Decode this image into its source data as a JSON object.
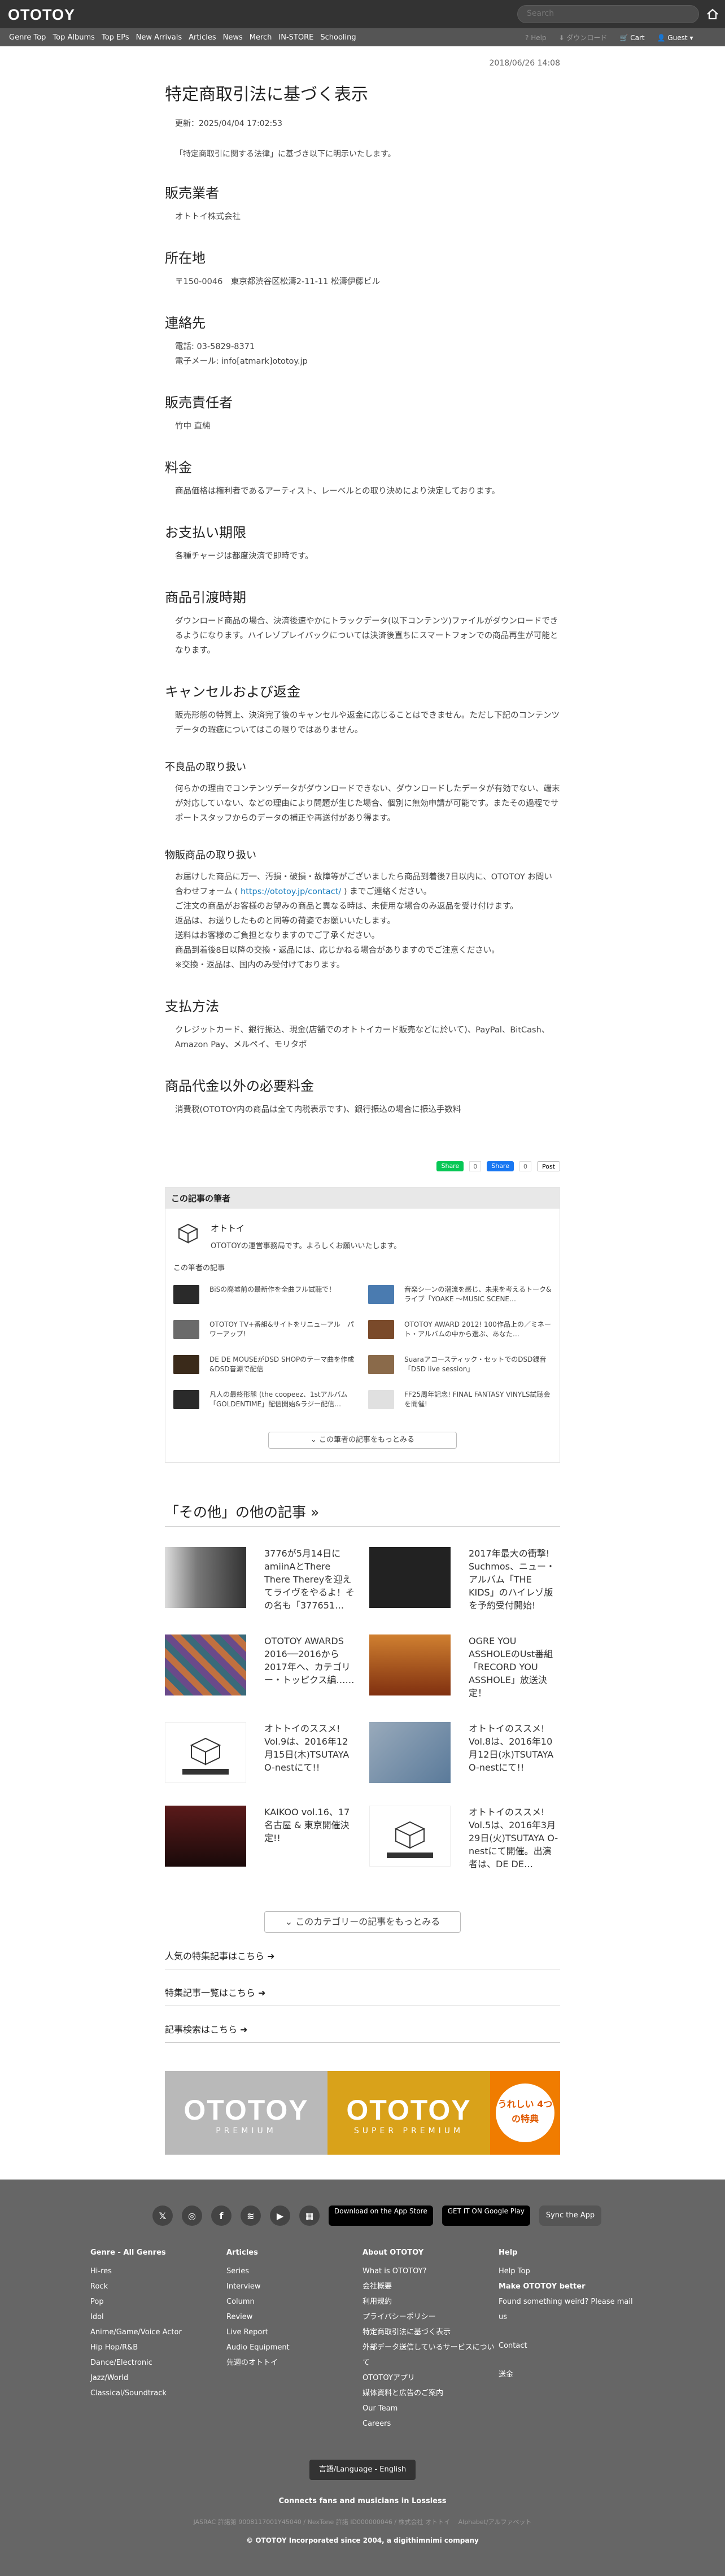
{
  "header": {
    "logo": "OTOTOY",
    "search_placeholder": "Search",
    "nav": [
      "Genre Top",
      "Top Albums",
      "Top EPs",
      "New Arrivals",
      "Articles",
      "News",
      "Merch",
      "IN-STORE",
      "Schooling"
    ],
    "help": "Help",
    "downloads": "ダウンロード",
    "cart": "Cart",
    "guest": "Guest"
  },
  "page": {
    "date": "2018/06/26 14:08",
    "title": "特定商取引法に基づく表示",
    "updated": "更新：2025/04/04 17:02:53",
    "lead": "「特定商取引に関する法律」に基づき以下に明示いたします。",
    "sections": [
      {
        "heading": "販売業者",
        "lines": [
          "オトトイ株式会社"
        ]
      },
      {
        "heading": "所在地",
        "lines": [
          "〒150-0046　東京都渋谷区松濤2-11-11 松濤伊藤ビル"
        ]
      },
      {
        "heading": "連絡先",
        "lines": [
          "電話: 03-5829-8371",
          "電子メール: info[atmark]ototoy.jp"
        ]
      },
      {
        "heading": "販売責任者",
        "lines": [
          "竹中 直純"
        ]
      },
      {
        "heading": "料金",
        "lines": [
          "商品価格は権利者であるアーティスト、レーベルとの取り決めにより決定しております。"
        ]
      },
      {
        "heading": "お支払い期限",
        "lines": [
          "各種チャージは都度決済で即時です。"
        ]
      },
      {
        "heading": "商品引渡時期",
        "lines": [
          "ダウンロード商品の場合、決済後速やかにトラックデータ(以下コンテンツ)ファイルがダウンロードできるようになります。ハイレゾプレイバックについては決済後直ちにスマートフォンでの商品再生が可能となります。"
        ]
      },
      {
        "heading": "キャンセルおよび返金",
        "lines": [
          "販売形態の特質上、決済完了後のキャンセルや返金に応じることはできません。ただし下記のコンテンツデータの瑕疵についてはこの限りではありません。"
        ]
      }
    ],
    "defect_heading": "不良品の取り扱い",
    "defect_text": "何らかの理由でコンテンツデータがダウンロードできない、ダウンロードしたデータが有効でない、端末が対応していない、などの理由により問題が生じた場合、個別に無効申請が可能です。またその過程でサポートスタッフからのデータの補正や再送付があり得ます。",
    "goods_heading": "物販商品の取り扱い",
    "goods_lines": [
      "お届けした商品に万一、汚損・破損・故障等がございましたら商品到着後7日以内に、OTOTOY お問い合わせフォーム ( ",
      "https://ototoy.jp/contact/",
      " ) までご連絡ください。",
      "ご注文の商品がお客様のお望みの商品と異なる時は、未使用な場合のみ返品を受け付けます。",
      "返品は、お送りしたものと同等の荷姿でお願いいたします。",
      "送料はお客様のご負担となりますのでご了承ください。",
      "商品到着後8日以降の交換・返品には、応じかねる場合がありますのでご注意ください。",
      "※交換・返品は、国内のみ受付けております。"
    ],
    "payment_heading": "支払方法",
    "payment_text": "クレジットカード、銀行振込、現金(店舗でのオトトイカード販売などに於いて)、PayPal、BitCash、Amazon Pay、メルペイ、モリタポ",
    "extra_heading": "商品代金以外の必要料金",
    "extra_text": "消費税(OTOTOY内の商品は全て内税表示です)、銀行振込の場合に振込手数料"
  },
  "share": {
    "line": "Share",
    "line_count": "0",
    "fb": "Share",
    "fb_count": "0",
    "x": "Post"
  },
  "author": {
    "heading": "この記事の筆者",
    "name": "オトトイ",
    "desc": "OTOTOYの運営事務局です。よろしくお願いいたします。",
    "related_label": "この筆者の記事",
    "articles": [
      {
        "text": "BiSの廃墟前の最新作を全曲フル試聴で！",
        "color": "#2a2a2a"
      },
      {
        "text": "音楽シーンの潮流を感じ、未来を考えるトーク&ライブ「YOAKE ～MUSIC SCENE…",
        "color": "#4a7bb0"
      },
      {
        "text": "OTOTOY TV+番組&サイトをリニューアル　パワーアップ!",
        "color": "#6a6a6a"
      },
      {
        "text": "OTOTOY AWARD 2012! 100作品上の／ミネート・アルバムの中から選ぶ、あなた…",
        "color": "#7a4a2a"
      },
      {
        "text": "DE DE MOUSEがDSD SHOPのテーマ曲を作成&DSD音源で配信",
        "color": "#3a2a1a"
      },
      {
        "text": "Suaraアコースティック・セットでのDSD録音「DSD live session」",
        "color": "#8a6a4a"
      },
      {
        "text": "凡人の最終形態 (the coopeez、1stアルバム「GOLDENTIME」配信開始&ラジー配信…",
        "color": "#2a2a2a"
      },
      {
        "text": "FF25周年記念! FINAL FANTASY VINYLS試聴会を開催!",
        "color": "#e0e0e0"
      }
    ],
    "more": "この筆者の記事をもっとみる"
  },
  "others": {
    "heading": "「その他」の他の記事 »",
    "items": [
      {
        "text": "3776が5月14日にamiinAとThere There Thereyを迎えてライヴをやるよ！その名も「377651…",
        "color": "#8a8a8a"
      },
      {
        "text": "2017年最大の衝撃! Suchmos、ニュー・アルバム「THE KIDS」のハイレゾ版を予約受付開始!",
        "color": "#222222"
      },
      {
        "text": "OTOTOY AWARDS 2016──2016から2017年へ、カテゴリー・トッピクス編……",
        "color": "#6a4a8a"
      },
      {
        "text": "OGRE YOU ASSHOLEのUst番組「RECORD YOU ASSHOLE」放送決定！",
        "color": "#a05a1a"
      },
      {
        "text": "オトトイのススメ! Vol.9は、2016年12月15日(木)TSUTAYA O-nestにて!!",
        "color": "#ffffff"
      },
      {
        "text": "オトトイのススメ! Vol.8は、2016年10月12日(水)TSUTAYA O-nestにて!!",
        "color": "#5a7a9a"
      },
      {
        "text": "KAIKOO vol.16、17名古屋 & 東京開催決定!!",
        "color": "#3a1a1a"
      },
      {
        "text": "オトトイのススメ! Vol.5は、2016年3月29日(火)TSUTAYA O-nestにて開催。出演者は、DE DE…",
        "color": "#ffffff"
      }
    ],
    "more": "このカテゴリーの記事をもっとみる"
  },
  "links": [
    "人気の特集記事はこちら",
    "特集記事一覧はこちら",
    "記事検索はこちら"
  ],
  "banner": {
    "premium": "OTOTOY",
    "premium_sub": "PREMIUM",
    "super": "OTOTOY",
    "super_sub": "SUPER PREMIUM",
    "bonus": "うれしい 4つの特典"
  },
  "footer": {
    "social": [
      "X",
      "Instagram",
      "Facebook",
      "Spotify",
      "YouTube",
      "Podcast"
    ],
    "app_store": "Download on the App Store",
    "google_play": "GET IT ON Google Play",
    "sync": "Sync the App",
    "cols": [
      {
        "heading": "Genre - All Genres",
        "items": [
          "Hi-res",
          "Rock",
          "Pop",
          "Idol",
          "Anime/Game/Voice Actor",
          "Hip Hop/R&B",
          "Dance/Electronic",
          "Jazz/World",
          "Classical/Soundtrack"
        ]
      },
      {
        "heading": "Articles",
        "items": [
          "Series",
          "Interview",
          "Column",
          "Review",
          "Live Report",
          "Audio Equipment",
          "先週のオトトイ"
        ]
      },
      {
        "heading": "About OTOTOY",
        "items": [
          "What is OTOTOY?",
          "会社概要",
          "利用規約",
          "プライバシーポリシー",
          "特定商取引法に基づく表示",
          "外部データ送信しているサービスについて",
          "OTOTOYアプリ",
          "媒体資料と広告のご案内",
          "Our Team",
          "Careers"
        ]
      },
      {
        "heading": "Help",
        "items": [
          "Help Top",
          "Make OTOTOY better",
          "Found something weird? Please mail us",
          "Contact",
          "送金"
        ]
      }
    ],
    "lang": "言語/Language - English",
    "tagline": "Connects fans and musicians in Lossless",
    "legal": "JASRAC 許諾第 9008117001Y45040 / NexTone 許諾 ID000000046 / 株式会社 オトトイ 　Alphabet/アルファベット",
    "copy": "© OTOTOY Incorporated since 2004, a digithimnimi company"
  }
}
